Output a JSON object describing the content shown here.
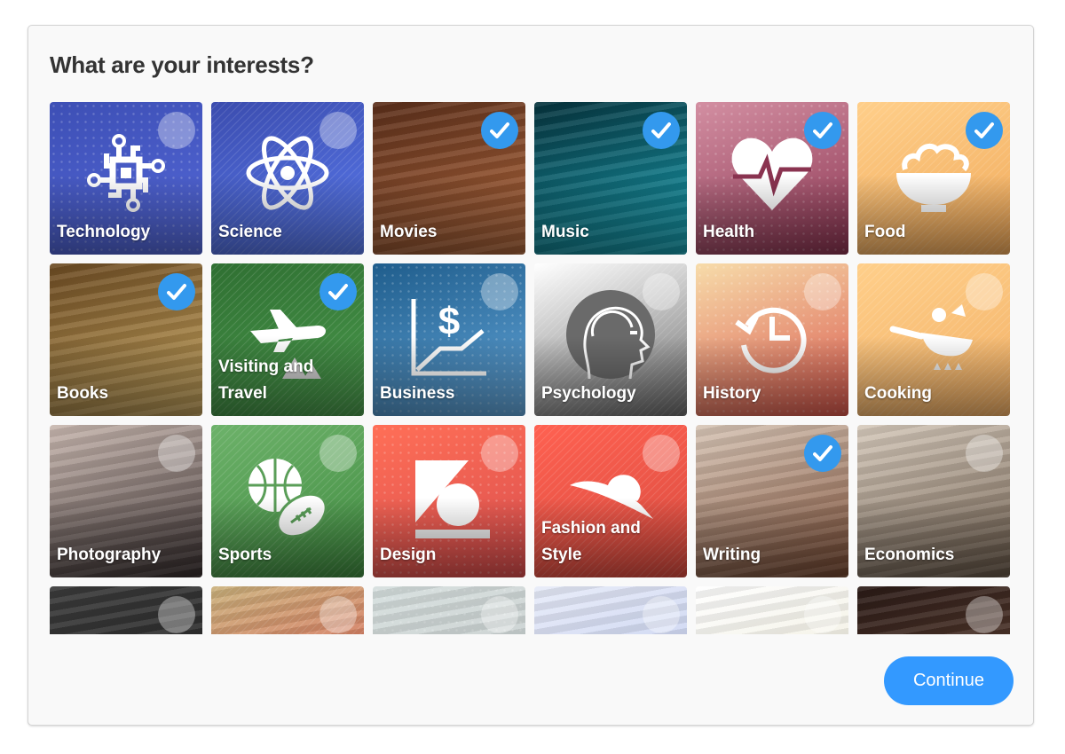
{
  "header": {
    "title": "What are your interests?"
  },
  "footer": {
    "continue_label": "Continue"
  },
  "colors": {
    "accent": "#3399ff",
    "check": "#3399ee",
    "title": "#333333",
    "panel_bg": "#f9f9f9"
  },
  "interests": [
    {
      "label": "Technology",
      "selected": false,
      "icon": "circuit-chip-icon",
      "bg": [
        "#3d4fb5",
        "#5468d8"
      ]
    },
    {
      "label": "Science",
      "selected": false,
      "icon": "atom-icon",
      "bg": [
        "#3b4cae",
        "#5a7bef"
      ]
    },
    {
      "label": "Movies",
      "selected": true,
      "icon": "film-reel-photo",
      "bg": [
        "#5a2e1a",
        "#b46a3e"
      ]
    },
    {
      "label": "Music",
      "selected": true,
      "icon": "microphone-photo",
      "bg": [
        "#06323c",
        "#1aa6b8"
      ]
    },
    {
      "label": "Health",
      "selected": true,
      "icon": "heartbeat-icon",
      "bg": [
        "#d38fa2",
        "#8a3350"
      ]
    },
    {
      "label": "Food",
      "selected": true,
      "icon": "rice-bowl-icon",
      "bg": [
        "#ffcf8a",
        "#f0a95a"
      ]
    },
    {
      "label": "Books",
      "selected": true,
      "icon": "books-photo",
      "bg": [
        "#6b4a22",
        "#c9a760"
      ]
    },
    {
      "label": "Visiting and Travel",
      "selected": true,
      "icon": "airplane-icon",
      "bg": [
        "#2f6f32",
        "#4a9a4c"
      ]
    },
    {
      "label": "Business",
      "selected": false,
      "icon": "chart-dollar-icon",
      "bg": [
        "#1f5d8c",
        "#63a6da"
      ]
    },
    {
      "label": "Psychology",
      "selected": false,
      "icon": "head-brain-icon",
      "bg": [
        "#ffffff",
        "#6a6a6a"
      ]
    },
    {
      "label": "History",
      "selected": false,
      "icon": "history-clock-icon",
      "bg": [
        "#f7dcaa",
        "#d9574c"
      ]
    },
    {
      "label": "Cooking",
      "selected": false,
      "icon": "frying-pan-icon",
      "bg": [
        "#ffcf8a",
        "#f2b066"
      ]
    },
    {
      "label": "Photography",
      "selected": false,
      "icon": "camera-photo",
      "bg": [
        "#c9b8b0",
        "#3a3030"
      ]
    },
    {
      "label": "Sports",
      "selected": false,
      "icon": "balls-icon",
      "bg": [
        "#6db26a",
        "#3f8a3f"
      ]
    },
    {
      "label": "Design",
      "selected": false,
      "icon": "shapes-icon",
      "bg": [
        "#ff6f57",
        "#d94d4d"
      ]
    },
    {
      "label": "Fashion and Style",
      "selected": false,
      "icon": "sun-hat-icon",
      "bg": [
        "#ff6151",
        "#d84b3f"
      ]
    },
    {
      "label": "Writing",
      "selected": true,
      "icon": "pen-hand-photo",
      "bg": [
        "#d8c7b8",
        "#7a4a32"
      ]
    },
    {
      "label": "Economics",
      "selected": false,
      "icon": "coins-chart-photo",
      "bg": [
        "#d7cbbd",
        "#6b5a4a"
      ]
    },
    {
      "label": "",
      "selected": false,
      "icon": "chalkboard-photo",
      "bg": [
        "#3a3a3a",
        "#222222"
      ]
    },
    {
      "label": "",
      "selected": false,
      "icon": "red-tan-pattern",
      "bg": [
        "#c9b07a",
        "#e0504c"
      ]
    },
    {
      "label": "",
      "selected": false,
      "icon": "grey-pattern",
      "bg": [
        "#d5dedd",
        "#bfc5c5"
      ]
    },
    {
      "label": "",
      "selected": false,
      "icon": "budget-paper-photo",
      "bg": [
        "#e7ebf8",
        "#b7c4ec"
      ]
    },
    {
      "label": "",
      "selected": false,
      "icon": "keyboard-photo",
      "bg": [
        "#ffffff",
        "#e9e5cf"
      ]
    },
    {
      "label": "",
      "selected": false,
      "icon": "people-photo",
      "bg": [
        "#2a1a16",
        "#6a4a3a"
      ]
    }
  ]
}
